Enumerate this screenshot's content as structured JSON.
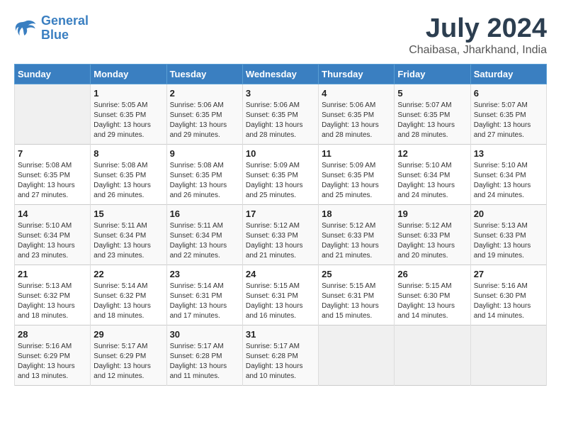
{
  "logo": {
    "line1": "General",
    "line2": "Blue"
  },
  "title": "July 2024",
  "location": "Chaibasa, Jharkhand, India",
  "headers": [
    "Sunday",
    "Monday",
    "Tuesday",
    "Wednesday",
    "Thursday",
    "Friday",
    "Saturday"
  ],
  "weeks": [
    [
      {
        "day": "",
        "sunrise": "",
        "sunset": "",
        "daylight": ""
      },
      {
        "day": "1",
        "sunrise": "Sunrise: 5:05 AM",
        "sunset": "Sunset: 6:35 PM",
        "daylight": "Daylight: 13 hours and 29 minutes."
      },
      {
        "day": "2",
        "sunrise": "Sunrise: 5:06 AM",
        "sunset": "Sunset: 6:35 PM",
        "daylight": "Daylight: 13 hours and 29 minutes."
      },
      {
        "day": "3",
        "sunrise": "Sunrise: 5:06 AM",
        "sunset": "Sunset: 6:35 PM",
        "daylight": "Daylight: 13 hours and 28 minutes."
      },
      {
        "day": "4",
        "sunrise": "Sunrise: 5:06 AM",
        "sunset": "Sunset: 6:35 PM",
        "daylight": "Daylight: 13 hours and 28 minutes."
      },
      {
        "day": "5",
        "sunrise": "Sunrise: 5:07 AM",
        "sunset": "Sunset: 6:35 PM",
        "daylight": "Daylight: 13 hours and 28 minutes."
      },
      {
        "day": "6",
        "sunrise": "Sunrise: 5:07 AM",
        "sunset": "Sunset: 6:35 PM",
        "daylight": "Daylight: 13 hours and 27 minutes."
      }
    ],
    [
      {
        "day": "7",
        "sunrise": "Sunrise: 5:08 AM",
        "sunset": "Sunset: 6:35 PM",
        "daylight": "Daylight: 13 hours and 27 minutes."
      },
      {
        "day": "8",
        "sunrise": "Sunrise: 5:08 AM",
        "sunset": "Sunset: 6:35 PM",
        "daylight": "Daylight: 13 hours and 26 minutes."
      },
      {
        "day": "9",
        "sunrise": "Sunrise: 5:08 AM",
        "sunset": "Sunset: 6:35 PM",
        "daylight": "Daylight: 13 hours and 26 minutes."
      },
      {
        "day": "10",
        "sunrise": "Sunrise: 5:09 AM",
        "sunset": "Sunset: 6:35 PM",
        "daylight": "Daylight: 13 hours and 25 minutes."
      },
      {
        "day": "11",
        "sunrise": "Sunrise: 5:09 AM",
        "sunset": "Sunset: 6:35 PM",
        "daylight": "Daylight: 13 hours and 25 minutes."
      },
      {
        "day": "12",
        "sunrise": "Sunrise: 5:10 AM",
        "sunset": "Sunset: 6:34 PM",
        "daylight": "Daylight: 13 hours and 24 minutes."
      },
      {
        "day": "13",
        "sunrise": "Sunrise: 5:10 AM",
        "sunset": "Sunset: 6:34 PM",
        "daylight": "Daylight: 13 hours and 24 minutes."
      }
    ],
    [
      {
        "day": "14",
        "sunrise": "Sunrise: 5:10 AM",
        "sunset": "Sunset: 6:34 PM",
        "daylight": "Daylight: 13 hours and 23 minutes."
      },
      {
        "day": "15",
        "sunrise": "Sunrise: 5:11 AM",
        "sunset": "Sunset: 6:34 PM",
        "daylight": "Daylight: 13 hours and 23 minutes."
      },
      {
        "day": "16",
        "sunrise": "Sunrise: 5:11 AM",
        "sunset": "Sunset: 6:34 PM",
        "daylight": "Daylight: 13 hours and 22 minutes."
      },
      {
        "day": "17",
        "sunrise": "Sunrise: 5:12 AM",
        "sunset": "Sunset: 6:33 PM",
        "daylight": "Daylight: 13 hours and 21 minutes."
      },
      {
        "day": "18",
        "sunrise": "Sunrise: 5:12 AM",
        "sunset": "Sunset: 6:33 PM",
        "daylight": "Daylight: 13 hours and 21 minutes."
      },
      {
        "day": "19",
        "sunrise": "Sunrise: 5:12 AM",
        "sunset": "Sunset: 6:33 PM",
        "daylight": "Daylight: 13 hours and 20 minutes."
      },
      {
        "day": "20",
        "sunrise": "Sunrise: 5:13 AM",
        "sunset": "Sunset: 6:33 PM",
        "daylight": "Daylight: 13 hours and 19 minutes."
      }
    ],
    [
      {
        "day": "21",
        "sunrise": "Sunrise: 5:13 AM",
        "sunset": "Sunset: 6:32 PM",
        "daylight": "Daylight: 13 hours and 18 minutes."
      },
      {
        "day": "22",
        "sunrise": "Sunrise: 5:14 AM",
        "sunset": "Sunset: 6:32 PM",
        "daylight": "Daylight: 13 hours and 18 minutes."
      },
      {
        "day": "23",
        "sunrise": "Sunrise: 5:14 AM",
        "sunset": "Sunset: 6:31 PM",
        "daylight": "Daylight: 13 hours and 17 minutes."
      },
      {
        "day": "24",
        "sunrise": "Sunrise: 5:15 AM",
        "sunset": "Sunset: 6:31 PM",
        "daylight": "Daylight: 13 hours and 16 minutes."
      },
      {
        "day": "25",
        "sunrise": "Sunrise: 5:15 AM",
        "sunset": "Sunset: 6:31 PM",
        "daylight": "Daylight: 13 hours and 15 minutes."
      },
      {
        "day": "26",
        "sunrise": "Sunrise: 5:15 AM",
        "sunset": "Sunset: 6:30 PM",
        "daylight": "Daylight: 13 hours and 14 minutes."
      },
      {
        "day": "27",
        "sunrise": "Sunrise: 5:16 AM",
        "sunset": "Sunset: 6:30 PM",
        "daylight": "Daylight: 13 hours and 14 minutes."
      }
    ],
    [
      {
        "day": "28",
        "sunrise": "Sunrise: 5:16 AM",
        "sunset": "Sunset: 6:29 PM",
        "daylight": "Daylight: 13 hours and 13 minutes."
      },
      {
        "day": "29",
        "sunrise": "Sunrise: 5:17 AM",
        "sunset": "Sunset: 6:29 PM",
        "daylight": "Daylight: 13 hours and 12 minutes."
      },
      {
        "day": "30",
        "sunrise": "Sunrise: 5:17 AM",
        "sunset": "Sunset: 6:28 PM",
        "daylight": "Daylight: 13 hours and 11 minutes."
      },
      {
        "day": "31",
        "sunrise": "Sunrise: 5:17 AM",
        "sunset": "Sunset: 6:28 PM",
        "daylight": "Daylight: 13 hours and 10 minutes."
      },
      {
        "day": "",
        "sunrise": "",
        "sunset": "",
        "daylight": ""
      },
      {
        "day": "",
        "sunrise": "",
        "sunset": "",
        "daylight": ""
      },
      {
        "day": "",
        "sunrise": "",
        "sunset": "",
        "daylight": ""
      }
    ]
  ]
}
